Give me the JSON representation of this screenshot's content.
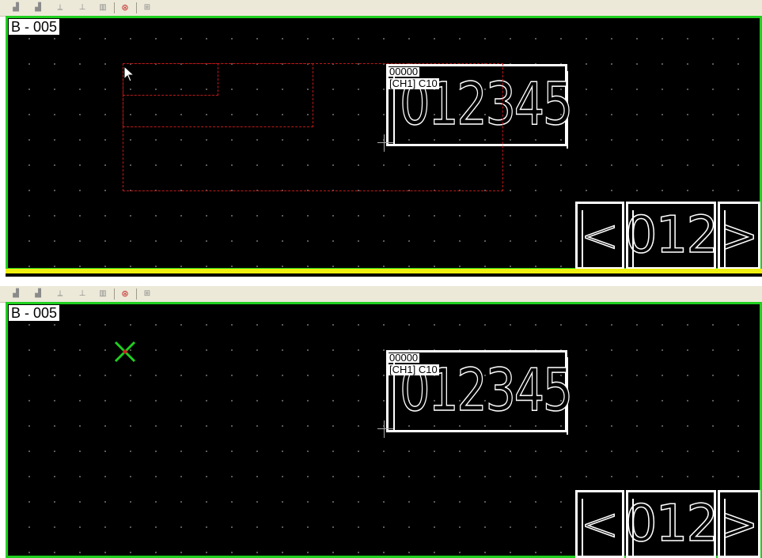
{
  "panels": [
    {
      "screen_label": "B - 005",
      "display": {
        "address": "00000",
        "channel": "[CH1] C10",
        "digits": "012345"
      },
      "nav": {
        "prev": "<",
        "number": "012",
        "next": ">"
      }
    },
    {
      "screen_label": "B - 005",
      "display": {
        "address": "00000",
        "channel": "[CH1] C10",
        "digits": "012345"
      },
      "nav": {
        "prev": "<",
        "number": "012",
        "next": ">"
      }
    }
  ],
  "colors": {
    "canvas_border": "#20d020",
    "selection": "#c01818",
    "marker": "#20d020"
  },
  "icons": [
    "toolbar-icon",
    "mouse-pointer-icon",
    "x-marker-icon"
  ]
}
